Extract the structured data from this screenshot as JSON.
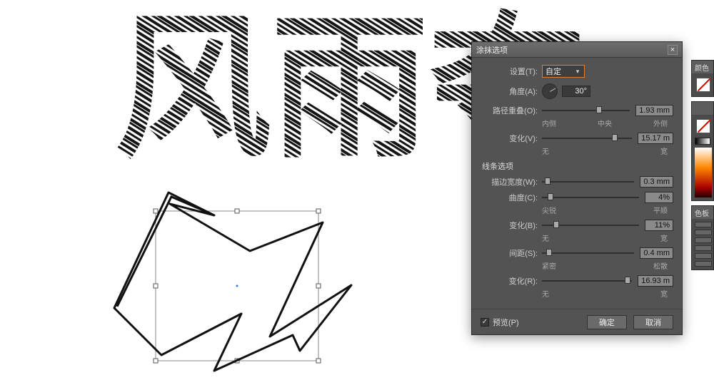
{
  "canvas": {
    "text_artwork": "风雨夺",
    "shape_note": "zigzag-path-with-bounding-box"
  },
  "dialog": {
    "title": "涂抹选项",
    "settings_label": "设置(T):",
    "settings_value": "自定",
    "angle_label": "角度(A):",
    "angle_value": "30°",
    "path_overlap": {
      "label": "路径重叠(O):",
      "value": "1.93 mm",
      "sub_left": "内侧",
      "sub_mid": "中央",
      "sub_right": "外侧",
      "pos": 62
    },
    "variation1": {
      "label": "变化(V):",
      "value": "15.17 m",
      "sub_left": "无",
      "sub_right": "宽",
      "pos": 78
    },
    "line_section": "线条选项",
    "stroke_width": {
      "label": "描边宽度(W):",
      "value": "0.3 mm",
      "pos": 3
    },
    "curvature": {
      "label": "曲度(C):",
      "value": "4%",
      "sub_left": "尖锐",
      "sub_right": "平顺",
      "pos": 6
    },
    "variation2": {
      "label": "变化(B):",
      "value": "11%",
      "sub_left": "无",
      "sub_right": "宽",
      "pos": 12
    },
    "spacing": {
      "label": "间距(S):",
      "value": "0.4 mm",
      "sub_left": "紧密",
      "sub_right": "松散",
      "pos": 5
    },
    "variation3": {
      "label": "变化(R):",
      "value": "16.93 m",
      "sub_left": "无",
      "sub_right": "宽",
      "pos": 92
    },
    "preview_label": "预览(P)",
    "ok_label": "确定",
    "cancel_label": "取消"
  },
  "panels": {
    "p1_title": "颜色",
    "p2_title": "",
    "p3_title": "",
    "p4_title": "色板"
  }
}
